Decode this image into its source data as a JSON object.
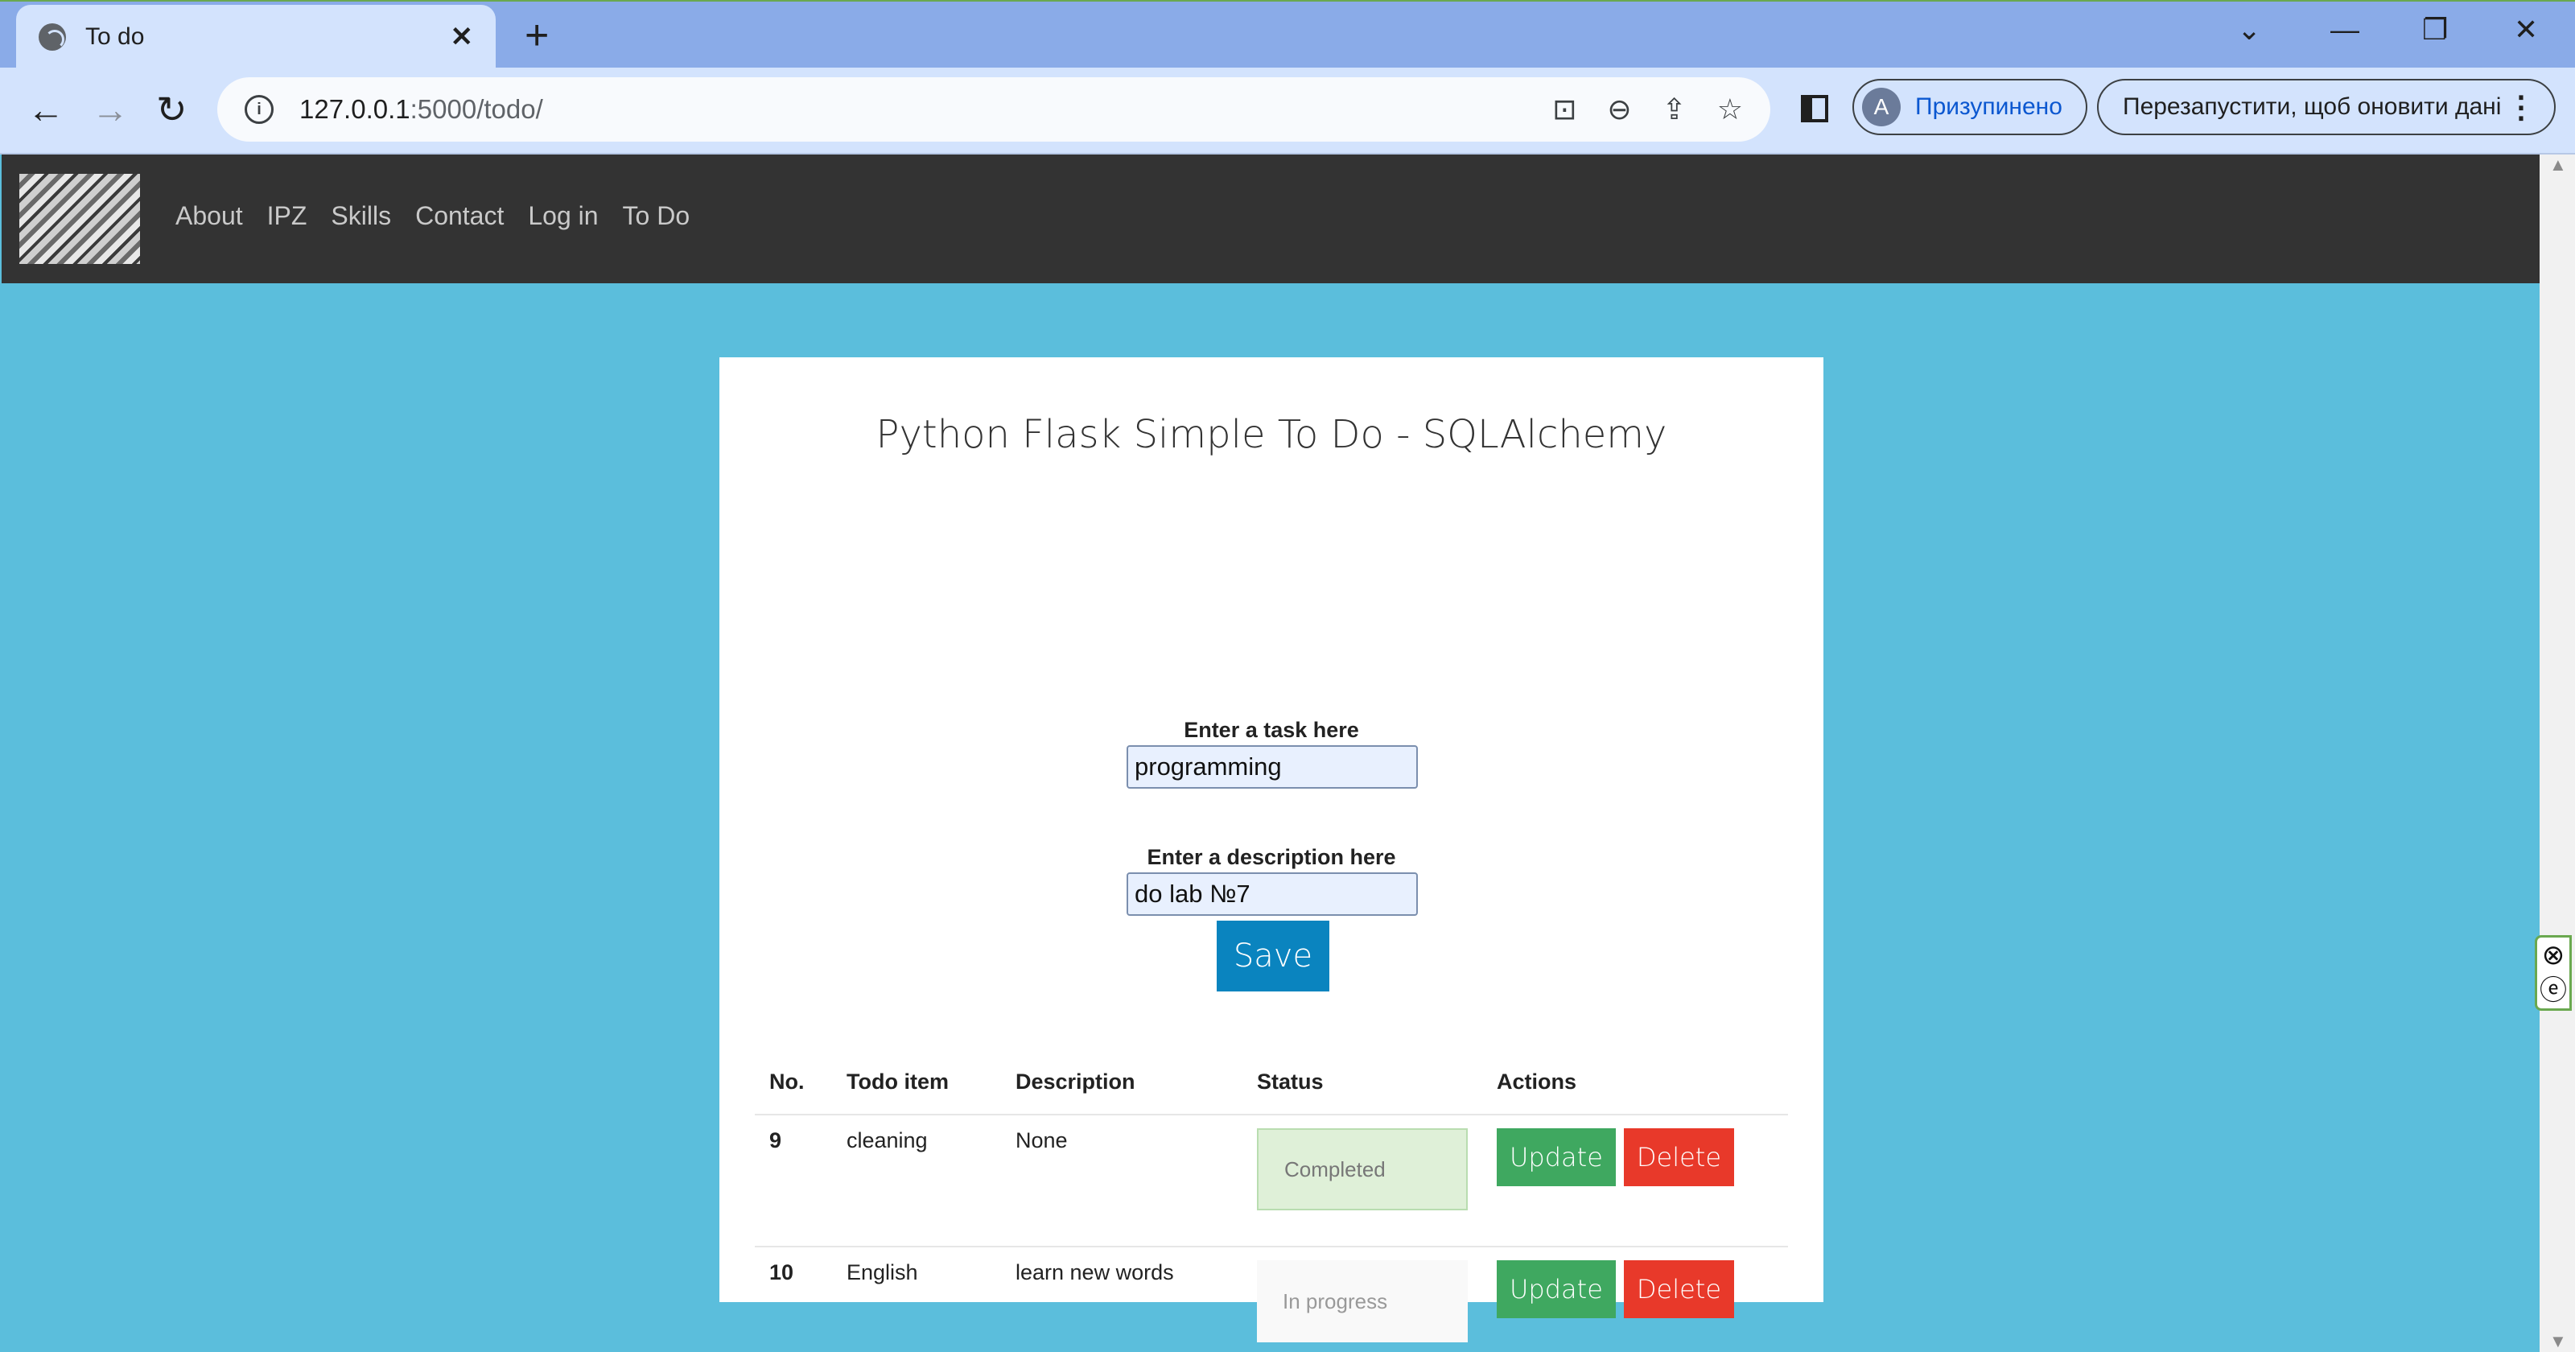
{
  "browser": {
    "tab_title": "To do",
    "url_host": "127.0.0.1",
    "url_rest": ":5000/todo/",
    "profile_initial": "A",
    "profile_label": "Призупинено",
    "restart_label": "Перезапустити, щоб оновити дані"
  },
  "site": {
    "nav": [
      "About",
      "IPZ",
      "Skills",
      "Contact",
      "Log in",
      "To Do"
    ]
  },
  "form": {
    "title": "Python Flask Simple To Do - SQLAlchemy",
    "task_label": "Enter a task here",
    "task_value": "programming",
    "desc_label": "Enter a description here",
    "desc_value": "do lab №7",
    "save_label": "Save"
  },
  "table": {
    "headers": [
      "No.",
      "Todo item",
      "Description",
      "Status",
      "Actions"
    ],
    "rows": [
      {
        "no": "9",
        "item": "cleaning",
        "description": "None",
        "status": "Completed",
        "update": "Update",
        "delete": "Delete"
      },
      {
        "no": "10",
        "item": "English",
        "description": "learn new words",
        "status": "In progress",
        "update": "Update",
        "delete": "Delete"
      }
    ]
  }
}
